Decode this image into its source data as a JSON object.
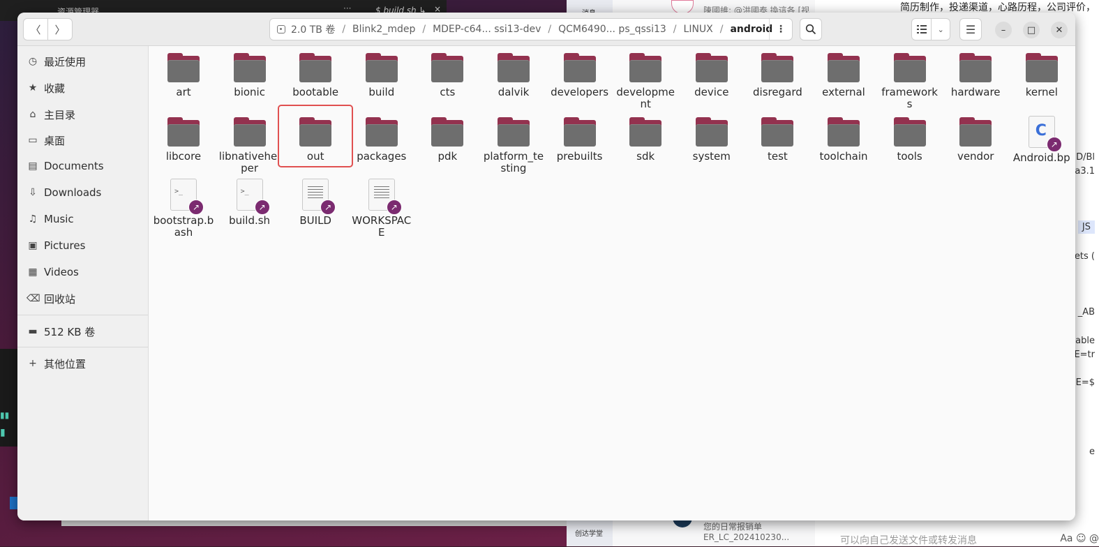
{
  "background": {
    "vscode": {
      "explorer_title": "资源管理器",
      "tab_label": "$ build.sh ↳",
      "tab_more": "···",
      "tab_close": "×"
    },
    "chat": {
      "sidebar_top": "消息",
      "sidebar_bottom": "创达学堂",
      "list_top_text": "陳國維: @洪國泰 換這各 [视频]",
      "list_bottom_text": "您的日常报销单ER_LC_202410230...",
      "conversation_top": "简历制作，投递渠道，心路历程，公司评价，",
      "input_placeholder": "可以向自己发送文件或转发消息",
      "input_tools": "Aa ☺ @",
      "peek_lines": [
        "D/Bl",
        "a3.1",
        "JS",
        "ets (",
        "_AB",
        "able",
        "E=tr",
        "E=$",
        "e"
      ]
    }
  },
  "window": {
    "path": {
      "volume": "2.0 TB 卷",
      "crumbs": [
        "Blink2_mdep",
        "MDEP-c64... ssi13-dev",
        "QCM6490... ps_qssi13",
        "LINUX"
      ],
      "current": "android"
    }
  },
  "sidebar": {
    "items": [
      {
        "icon": "clock-icon",
        "label": "最近使用"
      },
      {
        "icon": "star-icon",
        "label": "收藏"
      },
      {
        "icon": "home-icon",
        "label": "主目录"
      },
      {
        "icon": "desktop-icon",
        "label": "桌面"
      },
      {
        "icon": "document-icon",
        "label": "Documents"
      },
      {
        "icon": "download-icon",
        "label": "Downloads"
      },
      {
        "icon": "music-icon",
        "label": "Music"
      },
      {
        "icon": "picture-icon",
        "label": "Pictures"
      },
      {
        "icon": "video-icon",
        "label": "Videos"
      },
      {
        "icon": "trash-icon",
        "label": "回收站"
      }
    ],
    "volume": {
      "icon": "drive-icon",
      "label": "512 KB 卷"
    },
    "other": {
      "icon": "plus-icon",
      "label": "其他位置"
    }
  },
  "files": {
    "row1": [
      "art",
      "bionic",
      "bootable",
      "build",
      "cts",
      "dalvik",
      "developers",
      "development",
      "device",
      "disregard",
      "external",
      "frameworks",
      "hardware",
      "kernel"
    ],
    "row2": [
      "libcore",
      "libnativehelper",
      "out",
      "packages",
      "pdk",
      "platform_testing",
      "prebuilts",
      "sdk",
      "system",
      "test",
      "toolchain",
      "tools",
      "vendor"
    ],
    "android_bp": "Android.bp",
    "row3": [
      {
        "name": "bootstrap.bash",
        "kind": "script"
      },
      {
        "name": "build.sh",
        "kind": "script"
      },
      {
        "name": "BUILD",
        "kind": "text"
      },
      {
        "name": "WORKSPACE",
        "kind": "text"
      }
    ]
  },
  "selected_item": "out"
}
